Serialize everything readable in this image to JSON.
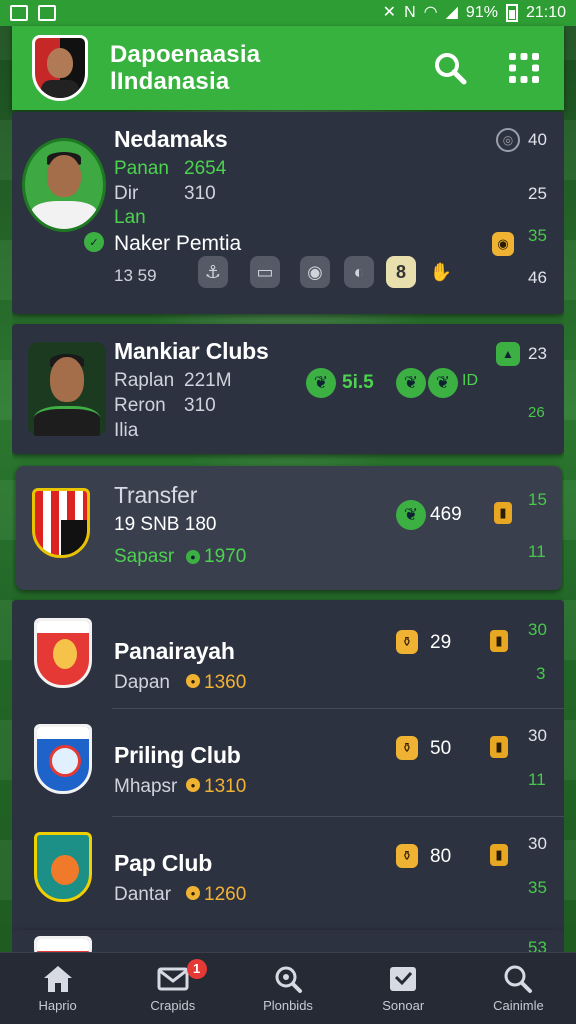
{
  "status_bar": {
    "battery_percent": "91%",
    "time": "21:10"
  },
  "app_bar": {
    "title_line1": "Dapoenaasia",
    "title_line2": "lIndanasia"
  },
  "player_card_1": {
    "name": "Nedamaks",
    "row1_label": "Panan",
    "row1_value": "2654",
    "row2_label": "Dir",
    "row2_value": "310",
    "row3_label": "Lan",
    "sub_name": "Naker Pemtia",
    "footer_value": "13 59",
    "right_top": "40",
    "right_mid": "25",
    "right_gold": "35",
    "right_bottom": "46",
    "toolbar_highlight": "8"
  },
  "player_card_2": {
    "name": "Mankiar Clubs",
    "row1_label": "Raplan",
    "row1_value": "221M",
    "row2_label": "Reron",
    "row2_value": "310",
    "row3_label": "Ilia",
    "rating": "5i.5",
    "rating_suffix": "ID",
    "right_top": "23",
    "right_bottom": "26"
  },
  "transfer_card": {
    "title": "Transfer",
    "sub": "19 SNB 180",
    "label": "Sapasr",
    "value": "1970",
    "mid_value": "469",
    "right_top": "15",
    "right_bottom": "11"
  },
  "clubs": [
    {
      "name": "Panairayah",
      "sub": "Dapan",
      "value": "1360",
      "score": "29",
      "right_top": "30",
      "right_bottom": "3"
    },
    {
      "name": "Priling Club",
      "sub": "Mhapsr",
      "value": "1310",
      "score": "50",
      "right_top": "30",
      "right_bottom": "11"
    },
    {
      "name": "Pap Club",
      "sub": "Dantar",
      "value": "1260",
      "score": "80",
      "right_top": "30",
      "right_bottom": "35"
    }
  ],
  "partial_row": {
    "right_top": "53"
  },
  "bottom_nav": {
    "items": [
      {
        "label": "Haprio"
      },
      {
        "label": "Crapids",
        "badge": "1"
      },
      {
        "label": "Plonbids"
      },
      {
        "label": "Sonoar"
      },
      {
        "label": "Cainimle"
      }
    ]
  },
  "colors": {
    "accent_green": "#37b23e",
    "card_bg": "#2d3240",
    "gold": "#f2b233",
    "badge_red": "#e53935"
  },
  "icons": {
    "search": "search-icon",
    "grid": "grid-dots-icon"
  }
}
